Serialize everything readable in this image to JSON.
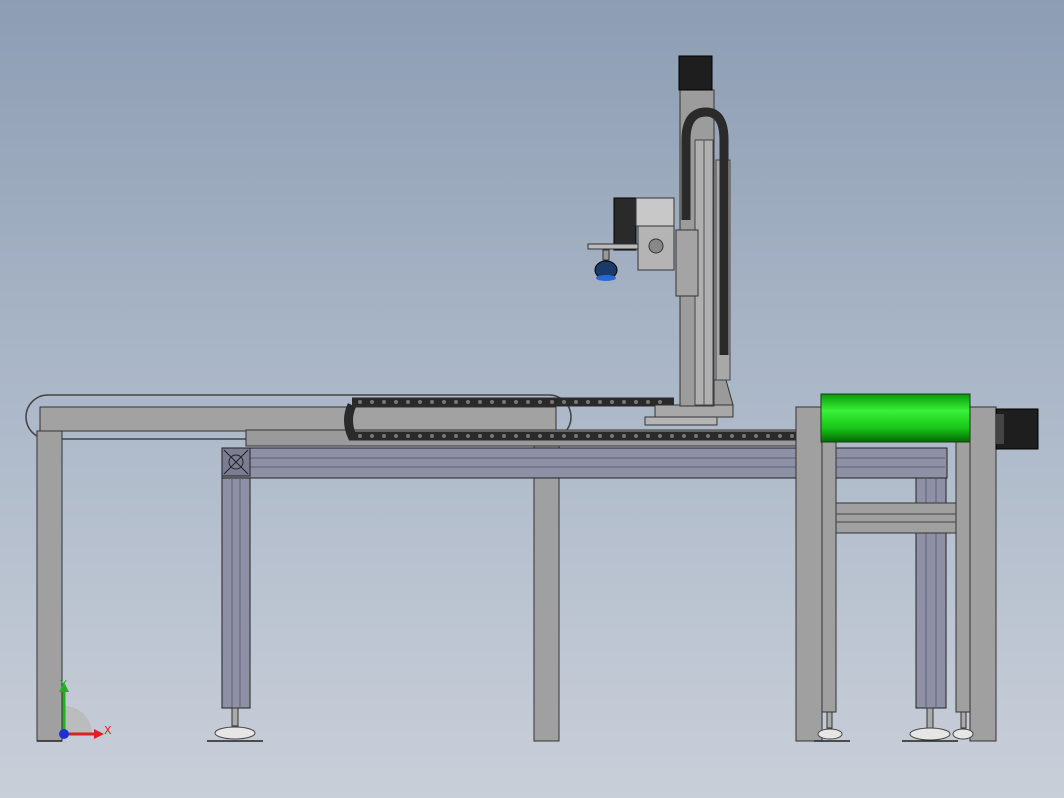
{
  "viewport": {
    "background_top": "#8d9db3",
    "background_bottom": "#c9cfd9"
  },
  "colors": {
    "frame_gray": "#a0a0a0",
    "profile_blue": "#8e91a6",
    "chain_black": "#2a2a2a",
    "roller_green": "#22dd22",
    "motor_black": "#1e1e1e"
  },
  "triad": {
    "x_label": "X",
    "y_label": "Y",
    "x_color": "#e02020",
    "y_color": "#20b020",
    "z_color": "#2030d0"
  }
}
